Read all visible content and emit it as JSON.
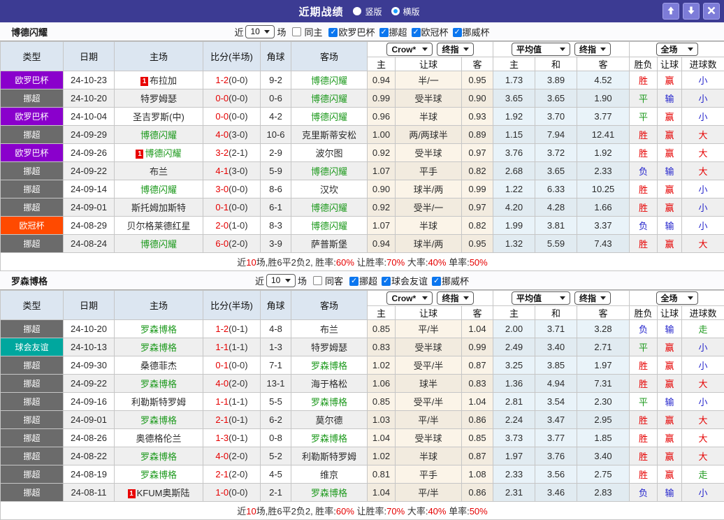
{
  "ui": {
    "title": "近期战绩",
    "layout_options": [
      {
        "label": "竖版",
        "selected": false
      },
      {
        "label": "横版",
        "selected": true
      }
    ],
    "window_icons": [
      "arrow-up-icon",
      "arrow-down-icon",
      "close-icon"
    ]
  },
  "palette": {
    "titlebar_bg": "#3c3b93",
    "red": "#e60000",
    "green": "#1e9a1e",
    "blue": "#2424cc",
    "header_cell_bg": "#dce6f1"
  },
  "league_colors": {
    "欧罗巴杯": "#8a00cc",
    "挪超": "#6b6b6b",
    "欧冠杯": "#ff4a00",
    "球会友谊": "#00a79e"
  },
  "result_colors": {
    "胜": "#e60000",
    "平": "#1e9a1e",
    "负": "#2424cc",
    "赢": "#e60000",
    "输": "#2424cc",
    "大": "#e60000",
    "小": "#2424cc",
    "走": "#1e9a1e"
  },
  "table_headers": {
    "static": [
      "类型",
      "日期",
      "主场",
      "比分(半场)",
      "角球",
      "客场"
    ],
    "odds_sub": [
      "主",
      "让球",
      "客"
    ],
    "avg_sub": [
      "主",
      "和",
      "客"
    ],
    "result_sub": [
      "胜负",
      "让球",
      "进球数"
    ]
  },
  "sections": [
    {
      "team": "博德闪耀",
      "filters": {
        "near": "近",
        "count": "10",
        "games": "场",
        "same": "同主",
        "same_checked": false,
        "leagues": [
          {
            "label": "欧罗巴杯",
            "checked": true
          },
          {
            "label": "挪超",
            "checked": true
          },
          {
            "label": "欧冠杯",
            "checked": true
          },
          {
            "label": "挪威杯",
            "checked": true
          }
        ]
      },
      "selects": {
        "odds_provider": "Crow*",
        "odds_stage": "终指",
        "avg": "平均值",
        "avg_stage": "终指",
        "scope": "全场"
      },
      "rows": [
        {
          "league": "欧罗巴杯",
          "date": "24-10-23",
          "home": {
            "name": "布拉加",
            "red": "1",
            "focus": false
          },
          "score": {
            "ft": "1-2",
            "ht": "(0-0)"
          },
          "corners": "9-2",
          "away": {
            "name": "博德闪耀",
            "focus": true
          },
          "odds": [
            "0.94",
            "半/一",
            "0.95"
          ],
          "avg": [
            "1.73",
            "3.89",
            "4.52"
          ],
          "result": [
            "胜",
            "赢",
            "小"
          ]
        },
        {
          "league": "挪超",
          "date": "24-10-20",
          "home": {
            "name": "特罗姆瑟",
            "focus": false
          },
          "score": {
            "ft": "0-0",
            "ht": "(0-0)"
          },
          "corners": "0-6",
          "away": {
            "name": "博德闪耀",
            "focus": true
          },
          "odds": [
            "0.99",
            "受半球",
            "0.90"
          ],
          "avg": [
            "3.65",
            "3.65",
            "1.90"
          ],
          "result": [
            "平",
            "输",
            "小"
          ]
        },
        {
          "league": "欧罗巴杯",
          "date": "24-10-04",
          "home": {
            "name": "圣吉罗斯(中)",
            "focus": false
          },
          "score": {
            "ft": "0-0",
            "ht": "(0-0)"
          },
          "corners": "4-2",
          "away": {
            "name": "博德闪耀",
            "focus": true
          },
          "odds": [
            "0.96",
            "半球",
            "0.93"
          ],
          "avg": [
            "1.92",
            "3.70",
            "3.77"
          ],
          "result": [
            "平",
            "赢",
            "小"
          ]
        },
        {
          "league": "挪超",
          "date": "24-09-29",
          "home": {
            "name": "博德闪耀",
            "focus": true
          },
          "score": {
            "ft": "4-0",
            "ht": "(3-0)"
          },
          "corners": "10-6",
          "away": {
            "name": "克里斯蒂安松",
            "focus": false
          },
          "odds": [
            "1.00",
            "两/两球半",
            "0.89"
          ],
          "avg": [
            "1.15",
            "7.94",
            "12.41"
          ],
          "result": [
            "胜",
            "赢",
            "大"
          ]
        },
        {
          "league": "欧罗巴杯",
          "date": "24-09-26",
          "home": {
            "name": "博德闪耀",
            "red": "1",
            "focus": true
          },
          "score": {
            "ft": "3-2",
            "ht": "(2-1)"
          },
          "corners": "2-9",
          "away": {
            "name": "波尔图",
            "focus": false
          },
          "odds": [
            "0.92",
            "受半球",
            "0.97"
          ],
          "avg": [
            "3.76",
            "3.72",
            "1.92"
          ],
          "result": [
            "胜",
            "赢",
            "大"
          ]
        },
        {
          "league": "挪超",
          "date": "24-09-22",
          "home": {
            "name": "布兰",
            "focus": false
          },
          "score": {
            "ft": "4-1",
            "ht": "(3-0)"
          },
          "corners": "5-9",
          "away": {
            "name": "博德闪耀",
            "focus": true
          },
          "odds": [
            "1.07",
            "平手",
            "0.82"
          ],
          "avg": [
            "2.68",
            "3.65",
            "2.33"
          ],
          "result": [
            "负",
            "输",
            "大"
          ]
        },
        {
          "league": "挪超",
          "date": "24-09-14",
          "home": {
            "name": "博德闪耀",
            "focus": true
          },
          "score": {
            "ft": "3-0",
            "ht": "(0-0)"
          },
          "corners": "8-6",
          "away": {
            "name": "汉坎",
            "focus": false
          },
          "odds": [
            "0.90",
            "球半/两",
            "0.99"
          ],
          "avg": [
            "1.22",
            "6.33",
            "10.25"
          ],
          "result": [
            "胜",
            "赢",
            "小"
          ]
        },
        {
          "league": "挪超",
          "date": "24-09-01",
          "home": {
            "name": "斯托姆加斯特",
            "focus": false
          },
          "score": {
            "ft": "0-1",
            "ht": "(0-0)"
          },
          "corners": "6-1",
          "away": {
            "name": "博德闪耀",
            "focus": true
          },
          "odds": [
            "0.92",
            "受半/一",
            "0.97"
          ],
          "avg": [
            "4.20",
            "4.28",
            "1.66"
          ],
          "result": [
            "胜",
            "赢",
            "小"
          ]
        },
        {
          "league": "欧冠杯",
          "date": "24-08-29",
          "home": {
            "name": "贝尔格莱德红星",
            "focus": false
          },
          "score": {
            "ft": "2-0",
            "ht": "(1-0)"
          },
          "corners": "8-3",
          "away": {
            "name": "博德闪耀",
            "focus": true
          },
          "odds": [
            "1.07",
            "半球",
            "0.82"
          ],
          "avg": [
            "1.99",
            "3.81",
            "3.37"
          ],
          "result": [
            "负",
            "输",
            "小"
          ]
        },
        {
          "league": "挪超",
          "date": "24-08-24",
          "home": {
            "name": "博德闪耀",
            "focus": true
          },
          "score": {
            "ft": "6-0",
            "ht": "(2-0)"
          },
          "corners": "3-9",
          "away": {
            "name": "萨普斯堡",
            "focus": false
          },
          "odds": [
            "0.94",
            "球半/两",
            "0.95"
          ],
          "avg": [
            "1.32",
            "5.59",
            "7.43"
          ],
          "result": [
            "胜",
            "赢",
            "大"
          ]
        }
      ],
      "summary": [
        [
          "近",
          "k"
        ],
        [
          "10",
          "r"
        ],
        [
          "场,胜6平2负2, 胜率:",
          "k"
        ],
        [
          "60%",
          "r"
        ],
        [
          " 让胜率:",
          "k"
        ],
        [
          "70%",
          "r"
        ],
        [
          " 大率:",
          "k"
        ],
        [
          "40%",
          "r"
        ],
        [
          " 单率:",
          "k"
        ],
        [
          "50%",
          "r"
        ]
      ]
    },
    {
      "team": "罗森博格",
      "filters": {
        "near": "近",
        "count": "10",
        "games": "场",
        "same": "同客",
        "same_checked": false,
        "leagues": [
          {
            "label": "挪超",
            "checked": true
          },
          {
            "label": "球会友谊",
            "checked": true
          },
          {
            "label": "挪威杯",
            "checked": true
          }
        ]
      },
      "selects": {
        "odds_provider": "Crow*",
        "odds_stage": "终指",
        "avg": "平均值",
        "avg_stage": "终指",
        "scope": "全场"
      },
      "rows": [
        {
          "league": "挪超",
          "date": "24-10-20",
          "home": {
            "name": "罗森博格",
            "focus": true
          },
          "score": {
            "ft": "1-2",
            "ht": "(0-1)"
          },
          "corners": "4-8",
          "away": {
            "name": "布兰",
            "focus": false
          },
          "odds": [
            "0.85",
            "平/半",
            "1.04"
          ],
          "avg": [
            "2.00",
            "3.71",
            "3.28"
          ],
          "result": [
            "负",
            "输",
            "走"
          ]
        },
        {
          "league": "球会友谊",
          "date": "24-10-13",
          "home": {
            "name": "罗森博格",
            "focus": true
          },
          "score": {
            "ft": "1-1",
            "ht": "(1-1)"
          },
          "corners": "1-3",
          "away": {
            "name": "特罗姆瑟",
            "focus": false
          },
          "odds": [
            "0.83",
            "受半球",
            "0.99"
          ],
          "avg": [
            "2.49",
            "3.40",
            "2.71"
          ],
          "result": [
            "平",
            "赢",
            "小"
          ]
        },
        {
          "league": "挪超",
          "date": "24-09-30",
          "home": {
            "name": "桑德菲杰",
            "focus": false
          },
          "score": {
            "ft": "0-1",
            "ht": "(0-0)"
          },
          "corners": "7-1",
          "away": {
            "name": "罗森博格",
            "focus": true
          },
          "odds": [
            "1.02",
            "受平/半",
            "0.87"
          ],
          "avg": [
            "3.25",
            "3.85",
            "1.97"
          ],
          "result": [
            "胜",
            "赢",
            "小"
          ]
        },
        {
          "league": "挪超",
          "date": "24-09-22",
          "home": {
            "name": "罗森博格",
            "focus": true
          },
          "score": {
            "ft": "4-0",
            "ht": "(2-0)"
          },
          "corners": "13-1",
          "away": {
            "name": "海于格松",
            "focus": false
          },
          "odds": [
            "1.06",
            "球半",
            "0.83"
          ],
          "avg": [
            "1.36",
            "4.94",
            "7.31"
          ],
          "result": [
            "胜",
            "赢",
            "大"
          ]
        },
        {
          "league": "挪超",
          "date": "24-09-16",
          "home": {
            "name": "利勒斯特罗姆",
            "focus": false
          },
          "score": {
            "ft": "1-1",
            "ht": "(1-1)"
          },
          "corners": "5-5",
          "away": {
            "name": "罗森博格",
            "focus": true
          },
          "odds": [
            "0.85",
            "受平/半",
            "1.04"
          ],
          "avg": [
            "2.81",
            "3.54",
            "2.30"
          ],
          "result": [
            "平",
            "输",
            "小"
          ]
        },
        {
          "league": "挪超",
          "date": "24-09-01",
          "home": {
            "name": "罗森博格",
            "focus": true
          },
          "score": {
            "ft": "2-1",
            "ht": "(0-1)"
          },
          "corners": "6-2",
          "away": {
            "name": "莫尔德",
            "focus": false
          },
          "odds": [
            "1.03",
            "平/半",
            "0.86"
          ],
          "avg": [
            "2.24",
            "3.47",
            "2.95"
          ],
          "result": [
            "胜",
            "赢",
            "大"
          ]
        },
        {
          "league": "挪超",
          "date": "24-08-26",
          "home": {
            "name": "奥德格伦兰",
            "focus": false
          },
          "score": {
            "ft": "1-3",
            "ht": "(0-1)"
          },
          "corners": "0-8",
          "away": {
            "name": "罗森博格",
            "focus": true
          },
          "odds": [
            "1.04",
            "受半球",
            "0.85"
          ],
          "avg": [
            "3.73",
            "3.77",
            "1.85"
          ],
          "result": [
            "胜",
            "赢",
            "大"
          ]
        },
        {
          "league": "挪超",
          "date": "24-08-22",
          "home": {
            "name": "罗森博格",
            "focus": true
          },
          "score": {
            "ft": "4-0",
            "ht": "(2-0)"
          },
          "corners": "5-2",
          "away": {
            "name": "利勒斯特罗姆",
            "focus": false
          },
          "odds": [
            "1.02",
            "半球",
            "0.87"
          ],
          "avg": [
            "1.97",
            "3.76",
            "3.40"
          ],
          "result": [
            "胜",
            "赢",
            "大"
          ]
        },
        {
          "league": "挪超",
          "date": "24-08-19",
          "home": {
            "name": "罗森博格",
            "focus": true
          },
          "score": {
            "ft": "2-1",
            "ht": "(2-0)"
          },
          "corners": "4-5",
          "away": {
            "name": "维京",
            "focus": false
          },
          "odds": [
            "0.81",
            "平手",
            "1.08"
          ],
          "avg": [
            "2.33",
            "3.56",
            "2.75"
          ],
          "result": [
            "胜",
            "赢",
            "走"
          ]
        },
        {
          "league": "挪超",
          "date": "24-08-11",
          "home": {
            "name": "KFUM奥斯陆",
            "red": "1",
            "focus": false
          },
          "score": {
            "ft": "1-0",
            "ht": "(0-0)"
          },
          "corners": "2-1",
          "away": {
            "name": "罗森博格",
            "focus": true
          },
          "odds": [
            "1.04",
            "平/半",
            "0.86"
          ],
          "avg": [
            "2.31",
            "3.46",
            "2.83"
          ],
          "result": [
            "负",
            "输",
            "小"
          ]
        }
      ],
      "summary": [
        [
          "近",
          "k"
        ],
        [
          "10",
          "r"
        ],
        [
          "场,胜6平2负2, 胜率:",
          "k"
        ],
        [
          "60%",
          "r"
        ],
        [
          " 让胜率:",
          "k"
        ],
        [
          "70%",
          "r"
        ],
        [
          " 大率:",
          "k"
        ],
        [
          "40%",
          "r"
        ],
        [
          " 单率:",
          "k"
        ],
        [
          "50%",
          "r"
        ]
      ]
    }
  ]
}
